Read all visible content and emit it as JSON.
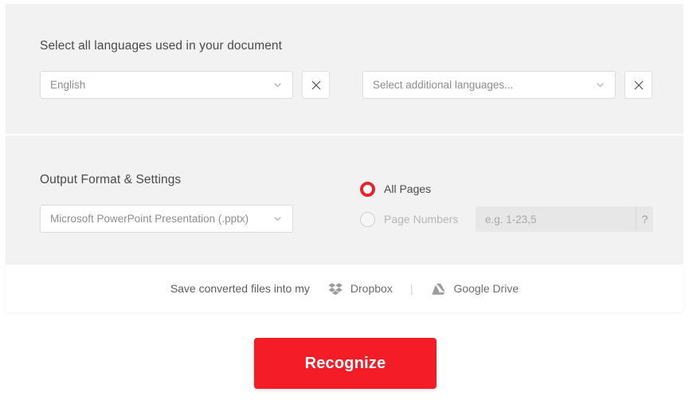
{
  "languages_section": {
    "title": "Select all languages used in your document",
    "primary_select": {
      "value": "English",
      "chevron_icon": "chevron-down-icon"
    },
    "primary_remove": {
      "icon": "close-icon"
    },
    "additional_select": {
      "value": "Select additional languages...",
      "chevron_icon": "chevron-down-icon"
    },
    "additional_remove": {
      "icon": "close-icon"
    }
  },
  "output_section": {
    "title": "Output Format & Settings",
    "format_select": {
      "value": "Microsoft PowerPoint Presentation (.pptx)",
      "chevron_icon": "chevron-down-icon"
    },
    "pages": {
      "all_pages_label": "All Pages",
      "all_pages_selected": true,
      "page_numbers_label": "Page Numbers",
      "page_numbers_selected": false,
      "page_numbers_value": "",
      "page_numbers_placeholder": "e.g. 1-23,5",
      "help_label": "?"
    }
  },
  "cloud_section": {
    "text": "Save converted files into my",
    "dropbox": {
      "label": "Dropbox",
      "icon": "dropbox-icon"
    },
    "separator": "|",
    "google_drive": {
      "label": "Google Drive",
      "icon": "google-drive-icon"
    }
  },
  "actions": {
    "recognize_label": "Recognize"
  },
  "colors": {
    "accent_red": "#f41c26",
    "radio_red": "#e8232a",
    "panel_grey": "#f2f2f2",
    "text_dark": "#4a4a4a",
    "text_muted": "#8e8e8e"
  }
}
